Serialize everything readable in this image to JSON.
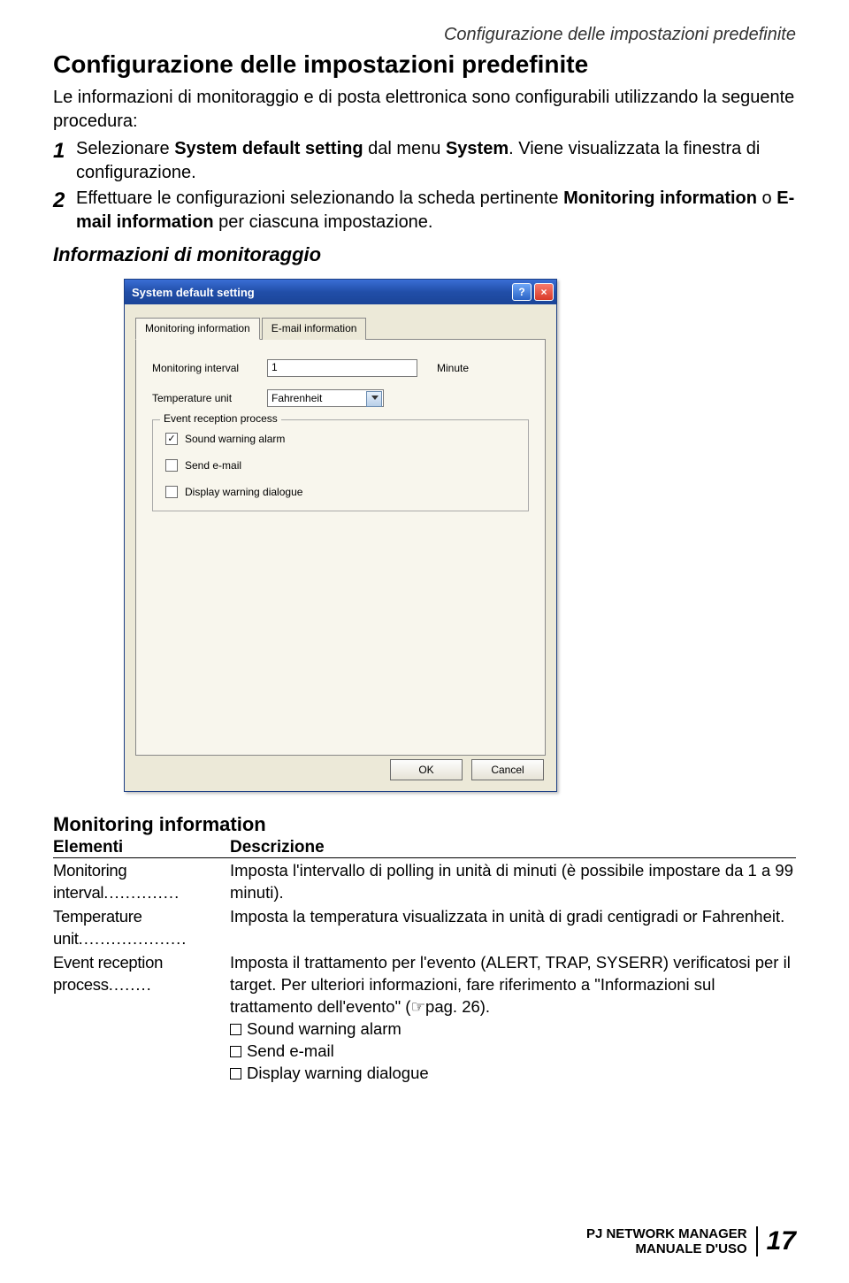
{
  "running_head": "Configurazione delle impostazioni predefinite",
  "h1": "Configurazione delle impostazioni predefinite",
  "intro": "Le informazioni di monitoraggio e di posta elettronica sono configurabili utilizzando la seguente procedura:",
  "steps": [
    {
      "n": "1",
      "html": "Selezionare <b>System default setting</b> dal menu <b>System</b>. Viene visualizzata la finestra di configurazione."
    },
    {
      "n": "2",
      "html": "Effettuare le configurazioni selezionando la scheda pertinente <b>Monitoring information</b> o <b>E-mail information</b> per ciascuna impostazione."
    }
  ],
  "subhead": "Informazioni di monitoraggio",
  "dialog": {
    "title": "System default setting",
    "help": "?",
    "close": "×",
    "tabs": {
      "tab1": "Monitoring information",
      "tab2": "E-mail information"
    },
    "rows": {
      "interval_label": "Monitoring interval",
      "interval_value": "1",
      "interval_suffix": "Minute",
      "tempunit_label": "Temperature unit",
      "tempunit_value": "Fahrenheit"
    },
    "group": {
      "legend": "Event reception process",
      "sound": "Sound warning alarm",
      "email": "Send e-mail",
      "display": "Display warning dialogue"
    },
    "buttons": {
      "ok": "OK",
      "cancel": "Cancel"
    }
  },
  "section_title": "Monitoring information",
  "table_head": {
    "a": "Elementi",
    "b": "Descrizione"
  },
  "desc": {
    "interval_label": "Monitoring interval",
    "interval_body": "Imposta l'intervallo di polling in unità di minuti (è possibile impostare da 1 a 99 minuti).",
    "temp_label": "Temperature unit",
    "temp_body": "Imposta la temperatura visualizzata in unità di gradi centigradi or Fahrenheit.",
    "event_label": "Event reception process",
    "event_body1": "Imposta il trattamento per l'evento (ALERT, TRAP, SYSERR) verificatosi per il target. Per ulteriori informazioni, fare riferimento a \"Informazioni sul trattamento dell'evento\" (☞pag. 26).",
    "event_sound": "Sound warning alarm",
    "event_mail": "Send e-mail",
    "event_display": "Display warning dialogue"
  },
  "footer": {
    "line1": "PJ NETWORK MANAGER",
    "line2": "MANUALE D'USO",
    "page": "17"
  }
}
